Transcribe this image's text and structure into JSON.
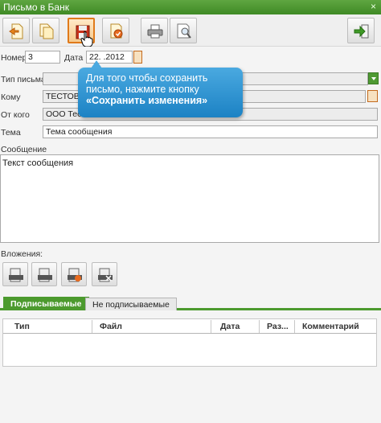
{
  "window": {
    "title": "Письмо в Банк",
    "close_glyph": "×"
  },
  "toolbar": {
    "buttons": [
      {
        "name": "new-letter-button",
        "icon": "new-document-icon"
      },
      {
        "name": "copy-button",
        "icon": "copy-icon"
      },
      {
        "name": "save-button",
        "icon": "save-icon",
        "state": "highlighted"
      },
      {
        "name": "sign-button",
        "icon": "sign-icon"
      },
      {
        "name": "print-button",
        "icon": "printer-icon"
      },
      {
        "name": "preview-button",
        "icon": "preview-icon"
      },
      {
        "name": "exit-button",
        "icon": "exit-icon"
      }
    ]
  },
  "form": {
    "number_label": "Номер",
    "number_value": "3",
    "date_label": "Дата",
    "date_value": "22.    .2012",
    "type_label": "Тип письма",
    "type_value": "",
    "to_label": "Кому",
    "to_value": "ТЕСТОВО",
    "from_label": "От кого",
    "from_value": "ООО Тест",
    "subject_label": "Тема",
    "subject_value": "Тема сообщения",
    "message_label": "Сообщение",
    "message_value": "Текст сообщения",
    "attachments_label": "Вложения:"
  },
  "tooltip": {
    "text": "Для того чтобы сохранить письмо, нажмите кнопку ",
    "bold": "«Сохранить изменения»"
  },
  "attachments_toolbar": [
    {
      "name": "attach-add-button",
      "icon": "attach-add-icon"
    },
    {
      "name": "attach-open-button",
      "icon": "attach-open-icon"
    },
    {
      "name": "attach-edit-button",
      "icon": "attach-edit-icon"
    },
    {
      "name": "attach-delete-button",
      "icon": "attach-delete-icon"
    }
  ],
  "tabs": {
    "signed": "Подписываемые",
    "unsigned": "Не подписываемые"
  },
  "table": {
    "columns": [
      "Тип",
      "Файл",
      "Дата",
      "Раз...",
      "Комментарий"
    ]
  },
  "colors": {
    "accent": "#4c9a2e",
    "tooltip": "#1c82c4",
    "highlight": "#e07a1a"
  }
}
